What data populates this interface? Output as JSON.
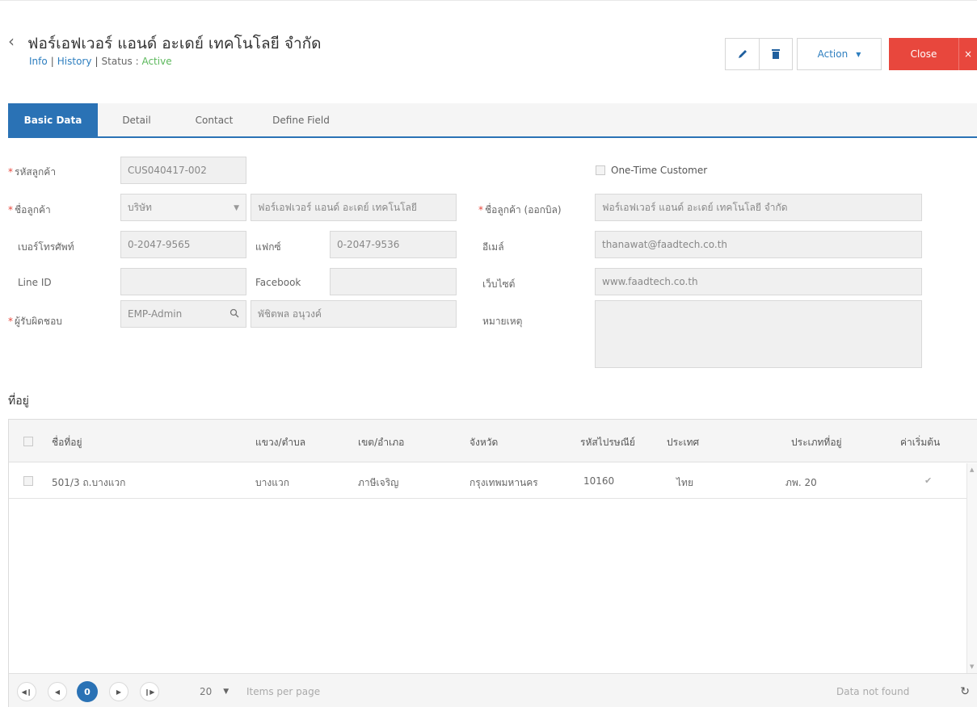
{
  "header": {
    "title": "ฟอร์เอฟเวอร์ แอนด์ อะเดย์ เทคโนโลยี จำกัด",
    "subnav": {
      "info": "Info",
      "history": "History",
      "status_label": "Status :",
      "status_value": "Active"
    },
    "toolbar": {
      "action_label": "Action",
      "close_label": "Close",
      "close_x": "×"
    },
    "icons": {
      "back": "chevron-left-icon",
      "edit": "pencil-icon",
      "delete": "trash-icon"
    },
    "colors": {
      "accent": "#2a72b5",
      "close": "#e8473d",
      "active": "#5cb85c"
    }
  },
  "tabs": [
    "Basic Data",
    "Detail",
    "Contact",
    "Define Field"
  ],
  "form": {
    "customer_code": {
      "label": "รหัสลูกค้า",
      "value": "CUS040417-002"
    },
    "one_time_customer": {
      "label": "One-Time Customer",
      "checked": false
    },
    "customer_name": {
      "label": "ชื่อลูกค้า",
      "prefix": "บริษัท",
      "value": "ฟอร์เอฟเวอร์ แอนด์ อะเดย์ เทคโนโลยี"
    },
    "billing_name": {
      "label": "ชื่อลูกค้า (ออกบิล)",
      "value": "ฟอร์เอฟเวอร์ แอนด์ อะเดย์ เทคโนโลยี จำกัด"
    },
    "phone": {
      "label": "เบอร์โทรศัพท์",
      "value": "0-2047-9565"
    },
    "fax": {
      "label": "แฟกซ์",
      "value": "0-2047-9536"
    },
    "email": {
      "label": "อีเมล์",
      "value": "thanawat@faadtech.co.th"
    },
    "line_id": {
      "label": "Line ID",
      "value": ""
    },
    "facebook": {
      "label": "Facebook",
      "value": ""
    },
    "website": {
      "label": "เว็บไซต์",
      "value": "www.faadtech.co.th"
    },
    "owner": {
      "label": "ผู้รับผิดชอบ",
      "code": "EMP-Admin",
      "name": "พัชิตพล อนุวงค์"
    },
    "note": {
      "label": "หมายเหตุ",
      "value": ""
    }
  },
  "address": {
    "section_title": "ที่อยู่",
    "columns": [
      "ชื่อที่อยู่",
      "แขวง/ตำบล",
      "เขต/อำเภอ",
      "จังหวัด",
      "รหัสไปรษณีย์",
      "ประเทศ",
      "ประเภทที่อยู่",
      "ค่าเริ่มต้น"
    ],
    "rows": [
      {
        "name": "501/3 ถ.บางแวก",
        "subdistrict": "บางแวก",
        "district": "ภาษีเจริญ",
        "province": "กรุงเทพมหานคร",
        "postcode": "10160",
        "country": "ไทย",
        "type": "ภพ. 20",
        "default": true
      }
    ],
    "pager": {
      "current_page": "0",
      "page_size": "20",
      "items_per_page": "Items per page",
      "status": "Data not found"
    }
  }
}
